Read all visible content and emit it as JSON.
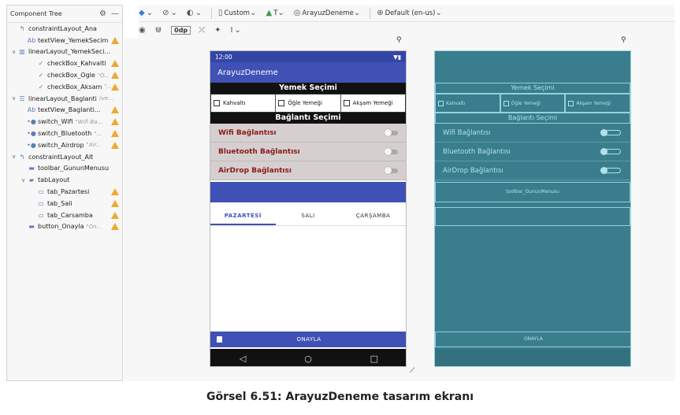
{
  "component_tree": {
    "title": "Component Tree",
    "items": [
      {
        "label": "constraintLayout_Ana",
        "sub": "",
        "warn": false,
        "indent": 0,
        "arrow": "",
        "icon": "constraint-layout-icon",
        "glyph": "↰"
      },
      {
        "label": "textView_YemekSecim",
        "sub": "",
        "warn": true,
        "indent": 1,
        "arrow": "",
        "icon": "textview-icon",
        "glyph": "Ab"
      },
      {
        "label": "linearLayout_YemekSeci...",
        "sub": "",
        "warn": false,
        "indent": 0,
        "arrow": "∨",
        "icon": "linear-horizontal-icon",
        "glyph": "▥"
      },
      {
        "label": "checkBox_Kahvalti",
        "sub": "",
        "warn": true,
        "indent": 2,
        "arrow": "",
        "icon": "checkbox-icon",
        "glyph": "✓"
      },
      {
        "label": "checkBox_Ogle",
        "sub": "\"Ö...",
        "warn": true,
        "indent": 2,
        "arrow": "",
        "icon": "checkbox-icon",
        "glyph": "✓"
      },
      {
        "label": "checkBox_Aksam",
        "sub": "\"...",
        "warn": true,
        "indent": 2,
        "arrow": "",
        "icon": "checkbox-icon",
        "glyph": "✓"
      },
      {
        "label": "linearLayout_Baglanti",
        "sub": "(ve...",
        "warn": false,
        "indent": 0,
        "arrow": "∨",
        "icon": "linear-vertical-icon",
        "glyph": "☰"
      },
      {
        "label": "textView_Baglanti...",
        "sub": "",
        "warn": true,
        "indent": 1,
        "arrow": "",
        "icon": "textview-icon",
        "glyph": "Ab"
      },
      {
        "label": "switch_Wifi",
        "sub": "\"Wifi Ba...",
        "warn": true,
        "indent": 1,
        "arrow": "",
        "icon": "switch-icon",
        "glyph": "•●"
      },
      {
        "label": "switch_Bluetooth",
        "sub": "\"...",
        "warn": true,
        "indent": 1,
        "arrow": "",
        "icon": "switch-icon",
        "glyph": "•●"
      },
      {
        "label": "switch_Airdrop",
        "sub": "\"Air...",
        "warn": true,
        "indent": 1,
        "arrow": "",
        "icon": "switch-icon",
        "glyph": "•●"
      },
      {
        "label": "constraintLayout_Alt",
        "sub": "",
        "warn": false,
        "indent": 0,
        "arrow": "∨",
        "icon": "constraint-layout-icon",
        "glyph": "↰"
      },
      {
        "label": "toolbar_GununMenusu",
        "sub": "",
        "warn": false,
        "indent": 1,
        "arrow": "",
        "icon": "toolbar-icon",
        "glyph": "▬"
      },
      {
        "label": "tabLayout",
        "sub": "",
        "warn": false,
        "indent": 1,
        "arrow": "∨",
        "icon": "folder-icon",
        "glyph": "▰"
      },
      {
        "label": "tab_Pazartesi",
        "sub": "",
        "warn": true,
        "indent": 2,
        "arrow": "",
        "icon": "tab-icon",
        "glyph": "▭"
      },
      {
        "label": "tab_Sali",
        "sub": "",
        "warn": true,
        "indent": 2,
        "arrow": "",
        "icon": "tab-icon",
        "glyph": "▭"
      },
      {
        "label": "tab_Carsamba",
        "sub": "",
        "warn": true,
        "indent": 2,
        "arrow": "",
        "icon": "tab-icon",
        "glyph": "▭"
      },
      {
        "label": "button_Onayla",
        "sub": "\"On...",
        "warn": true,
        "indent": 1,
        "arrow": "",
        "icon": "button-icon",
        "glyph": "▬"
      }
    ]
  },
  "toolbar": {
    "device": "Custom",
    "api": "T",
    "theme": "ArayuzDeneme",
    "locale": "Default (en-us)",
    "margin": "0dp"
  },
  "phone": {
    "time": "12:00",
    "app_title": "ArayuzDeneme",
    "section1": "Yemek Seçimi",
    "checkboxes": [
      "Kahvaltı",
      "Öğle Yemeği",
      "Akşam Yemeği"
    ],
    "section2": "Bağlantı Seçimi",
    "switches": [
      "Wifi Bağlantısı",
      "Bluetooth Bağlantısı",
      "AirDrop Bağlantısı"
    ],
    "tabs": [
      "PAZARTESİ",
      "SALI",
      "ÇARŞAMBA"
    ],
    "button": "ONAYLA"
  },
  "blueprint": {
    "section1": "Yemek Seçimi",
    "checkboxes": [
      "Kahvaltı",
      "Öğle Yemeği",
      "Akşam Yemeği"
    ],
    "section2": "Bağlantı Seçimi",
    "switches": [
      "Wifi Bağlantısı",
      "Bluetooth Bağlantısı",
      "AirDrop Bağlantısı"
    ],
    "toolbar": "toolbar_GununMenusu",
    "button": "ONAYLA"
  },
  "caption": "Görsel 6.51: ArayuzDeneme tasarım ekranı",
  "colors": {
    "primary": "#3f51b5",
    "blueprint_bg": "#3a7d8c",
    "warning": "#f0a830",
    "switch_label": "#8a1a1a"
  }
}
